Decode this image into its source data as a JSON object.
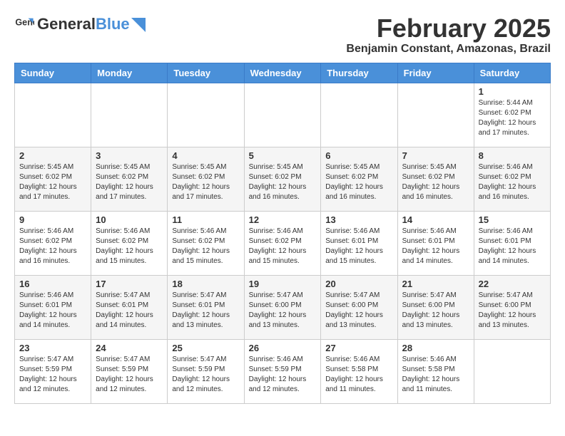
{
  "header": {
    "logo_general": "General",
    "logo_blue": "Blue",
    "title": "February 2025",
    "subtitle": "Benjamin Constant, Amazonas, Brazil"
  },
  "days_of_week": [
    "Sunday",
    "Monday",
    "Tuesday",
    "Wednesday",
    "Thursday",
    "Friday",
    "Saturday"
  ],
  "weeks": [
    {
      "days": [
        {
          "number": "",
          "info": ""
        },
        {
          "number": "",
          "info": ""
        },
        {
          "number": "",
          "info": ""
        },
        {
          "number": "",
          "info": ""
        },
        {
          "number": "",
          "info": ""
        },
        {
          "number": "",
          "info": ""
        },
        {
          "number": "1",
          "info": "Sunrise: 5:44 AM\nSunset: 6:02 PM\nDaylight: 12 hours and 17 minutes."
        }
      ]
    },
    {
      "days": [
        {
          "number": "2",
          "info": "Sunrise: 5:45 AM\nSunset: 6:02 PM\nDaylight: 12 hours and 17 minutes."
        },
        {
          "number": "3",
          "info": "Sunrise: 5:45 AM\nSunset: 6:02 PM\nDaylight: 12 hours and 17 minutes."
        },
        {
          "number": "4",
          "info": "Sunrise: 5:45 AM\nSunset: 6:02 PM\nDaylight: 12 hours and 17 minutes."
        },
        {
          "number": "5",
          "info": "Sunrise: 5:45 AM\nSunset: 6:02 PM\nDaylight: 12 hours and 16 minutes."
        },
        {
          "number": "6",
          "info": "Sunrise: 5:45 AM\nSunset: 6:02 PM\nDaylight: 12 hours and 16 minutes."
        },
        {
          "number": "7",
          "info": "Sunrise: 5:45 AM\nSunset: 6:02 PM\nDaylight: 12 hours and 16 minutes."
        },
        {
          "number": "8",
          "info": "Sunrise: 5:46 AM\nSunset: 6:02 PM\nDaylight: 12 hours and 16 minutes."
        }
      ]
    },
    {
      "days": [
        {
          "number": "9",
          "info": "Sunrise: 5:46 AM\nSunset: 6:02 PM\nDaylight: 12 hours and 16 minutes."
        },
        {
          "number": "10",
          "info": "Sunrise: 5:46 AM\nSunset: 6:02 PM\nDaylight: 12 hours and 15 minutes."
        },
        {
          "number": "11",
          "info": "Sunrise: 5:46 AM\nSunset: 6:02 PM\nDaylight: 12 hours and 15 minutes."
        },
        {
          "number": "12",
          "info": "Sunrise: 5:46 AM\nSunset: 6:02 PM\nDaylight: 12 hours and 15 minutes."
        },
        {
          "number": "13",
          "info": "Sunrise: 5:46 AM\nSunset: 6:01 PM\nDaylight: 12 hours and 15 minutes."
        },
        {
          "number": "14",
          "info": "Sunrise: 5:46 AM\nSunset: 6:01 PM\nDaylight: 12 hours and 14 minutes."
        },
        {
          "number": "15",
          "info": "Sunrise: 5:46 AM\nSunset: 6:01 PM\nDaylight: 12 hours and 14 minutes."
        }
      ]
    },
    {
      "days": [
        {
          "number": "16",
          "info": "Sunrise: 5:46 AM\nSunset: 6:01 PM\nDaylight: 12 hours and 14 minutes."
        },
        {
          "number": "17",
          "info": "Sunrise: 5:47 AM\nSunset: 6:01 PM\nDaylight: 12 hours and 14 minutes."
        },
        {
          "number": "18",
          "info": "Sunrise: 5:47 AM\nSunset: 6:01 PM\nDaylight: 12 hours and 13 minutes."
        },
        {
          "number": "19",
          "info": "Sunrise: 5:47 AM\nSunset: 6:00 PM\nDaylight: 12 hours and 13 minutes."
        },
        {
          "number": "20",
          "info": "Sunrise: 5:47 AM\nSunset: 6:00 PM\nDaylight: 12 hours and 13 minutes."
        },
        {
          "number": "21",
          "info": "Sunrise: 5:47 AM\nSunset: 6:00 PM\nDaylight: 12 hours and 13 minutes."
        },
        {
          "number": "22",
          "info": "Sunrise: 5:47 AM\nSunset: 6:00 PM\nDaylight: 12 hours and 13 minutes."
        }
      ]
    },
    {
      "days": [
        {
          "number": "23",
          "info": "Sunrise: 5:47 AM\nSunset: 5:59 PM\nDaylight: 12 hours and 12 minutes."
        },
        {
          "number": "24",
          "info": "Sunrise: 5:47 AM\nSunset: 5:59 PM\nDaylight: 12 hours and 12 minutes."
        },
        {
          "number": "25",
          "info": "Sunrise: 5:47 AM\nSunset: 5:59 PM\nDaylight: 12 hours and 12 minutes."
        },
        {
          "number": "26",
          "info": "Sunrise: 5:46 AM\nSunset: 5:59 PM\nDaylight: 12 hours and 12 minutes."
        },
        {
          "number": "27",
          "info": "Sunrise: 5:46 AM\nSunset: 5:58 PM\nDaylight: 12 hours and 11 minutes."
        },
        {
          "number": "28",
          "info": "Sunrise: 5:46 AM\nSunset: 5:58 PM\nDaylight: 12 hours and 11 minutes."
        },
        {
          "number": "",
          "info": ""
        }
      ]
    }
  ]
}
